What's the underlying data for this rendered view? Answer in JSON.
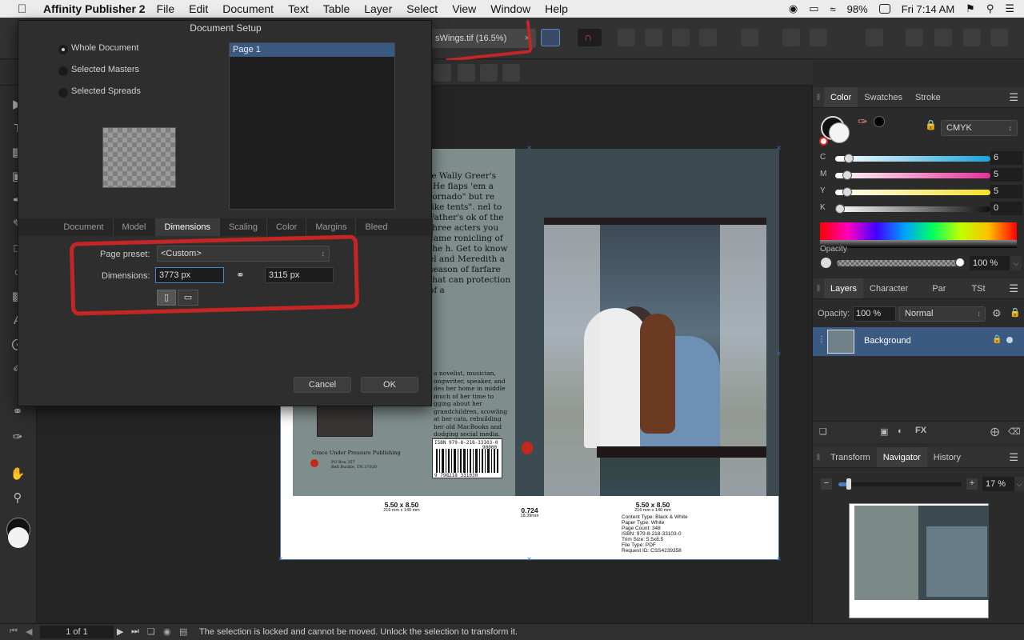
{
  "menubar": {
    "app_name": "Affinity Publisher 2",
    "items": [
      "File",
      "Edit",
      "Document",
      "Text",
      "Table",
      "Layer",
      "Select",
      "View",
      "Window",
      "Help"
    ],
    "battery": "98%",
    "clock": "Fri 7:14 AM"
  },
  "toolbar": {
    "doc_tab_title": "sWings.tif (16.5%)",
    "doc_tab_close": "×"
  },
  "dialog": {
    "title": "Document Setup",
    "scope_options": [
      {
        "label": "Whole Document",
        "selected": true
      },
      {
        "label": "Selected Masters",
        "selected": false
      },
      {
        "label": "Selected Spreads",
        "selected": false
      }
    ],
    "page_list": [
      "Page 1"
    ],
    "tabs": [
      "Document",
      "Model",
      "Dimensions",
      "Scaling",
      "Color",
      "Margins",
      "Bleed"
    ],
    "active_tab": "Dimensions",
    "page_preset_label": "Page preset:",
    "page_preset_value": "<Custom>",
    "dimensions_label": "Dimensions:",
    "width_value": "3773 px",
    "height_value": "3115 px",
    "cancel_label": "Cancel",
    "ok_label": "OK"
  },
  "canvas": {
    "back_cover_text": "le Wally Greer's \"He flaps 'em a tornado\" but re like tents\". nel to Father's ok of the three acters you came ronicling of the h. Get to know el and Meredith a season of farfare that can protection of a",
    "author_bio": "a novelist, musician, ongwriter, speaker, and des her home in middle much of her time to gging about her grandchildren, scowling at her cats, rebuilding her old MacBooks and dodging social media.",
    "publisher_name": "Grace Under Pressure Publishing",
    "publisher_address": "PO Box 357\nBell Buckle, TN 37020",
    "isbn": "ISBN 979-8-218-33103-0",
    "isbn_price": "90000",
    "barcode_number": "9 798218 331030",
    "left_size": "5.50 x 8.50",
    "left_size_mm": "216 mm x 140 mm",
    "spine_width": "0.724",
    "spine_width_mm": "18.39mm",
    "right_size": "5.50 x 8.50",
    "right_size_mm": "216 mm x 140 mm",
    "specs": [
      "Content Type: Black & White",
      "Paper Type: White",
      "Page Count: 348",
      "ISBN: 979-8-218-33103-0",
      "Trim Size: 5.5x8.5",
      "File Type: PDF",
      "Request ID: CSS4239358"
    ]
  },
  "color_panel": {
    "tabs": [
      "Color",
      "Swatches",
      "Stroke"
    ],
    "active_tab": "Color",
    "mode": "CMYK",
    "channels": [
      {
        "label": "C",
        "value": "6",
        "fraction": 0.06,
        "color": "#1aa3dc"
      },
      {
        "label": "M",
        "value": "5",
        "fraction": 0.05,
        "color": "#e8309a"
      },
      {
        "label": "Y",
        "value": "5",
        "fraction": 0.05,
        "color": "#f3e02a"
      },
      {
        "label": "K",
        "value": "0",
        "fraction": 0.0,
        "color": "#111111"
      }
    ],
    "opacity_label": "Opacity",
    "opacity_value": "100 %"
  },
  "layers_panel": {
    "tabs": [
      "Layers",
      "Character",
      "Par",
      "TSt"
    ],
    "active_tab": "Layers",
    "opacity_label": "Opacity:",
    "opacity_value": "100 %",
    "blend_mode": "Normal",
    "layer_name": "Background"
  },
  "navigator_panel": {
    "tabs": [
      "Transform",
      "Navigator",
      "History"
    ],
    "active_tab": "Navigator",
    "zoom_value": "17 %"
  },
  "status": {
    "page_indicator": "1 of 1",
    "message": "The selection is locked and cannot be moved. Unlock the selection to transform it."
  }
}
